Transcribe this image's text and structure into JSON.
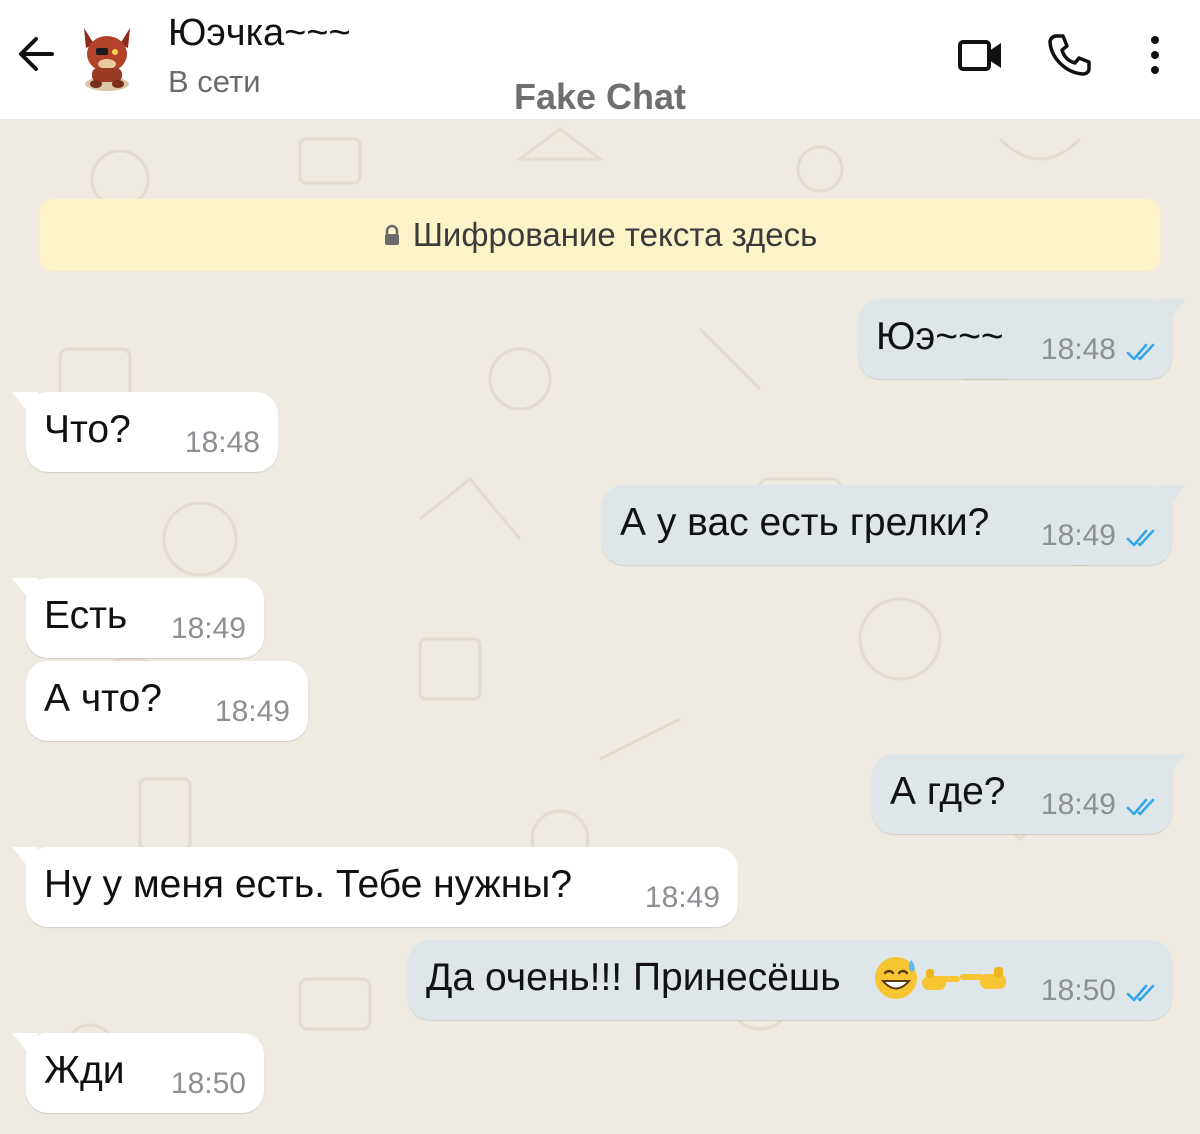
{
  "header": {
    "contact_name": "Юэчка~~~",
    "status": "В сети",
    "watermark": "Fake Chat",
    "icons": [
      "back-arrow-icon",
      "video-call-icon",
      "phone-icon",
      "more-options-icon"
    ]
  },
  "encryption_notice": "Шифрование текста здесь",
  "messages": [
    {
      "dir": "out",
      "text": "Юэ~~~",
      "time": "18:48",
      "read": true
    },
    {
      "dir": "in",
      "text": "Что?",
      "time": "18:48"
    },
    {
      "dir": "out",
      "text": "А у вас есть грелки?",
      "time": "18:49",
      "read": true
    },
    {
      "dir": "in",
      "text": "Есть",
      "time": "18:49"
    },
    {
      "dir": "in",
      "text": "А что?",
      "time": "18:49"
    },
    {
      "dir": "out",
      "text": "А где?",
      "time": "18:49",
      "read": true
    },
    {
      "dir": "in",
      "text": "Ну у меня есть. Тебе нужны?",
      "time": "18:49"
    },
    {
      "dir": "out",
      "text": "Да очень!!! Принесёшь",
      "emoji": [
        "grinning-sweat-emoji",
        "pointing-right-emoji",
        "pointing-left-emoji"
      ],
      "time": "18:50",
      "read": true
    },
    {
      "dir": "in",
      "text": "Жди",
      "time": "18:50"
    }
  ],
  "colors": {
    "chat_background": "#efeae2",
    "outgoing_bubble": "#dfe6ea",
    "incoming_bubble": "#ffffff",
    "banner": "#fcf4c8",
    "read_ticks": "#34a6e8"
  }
}
